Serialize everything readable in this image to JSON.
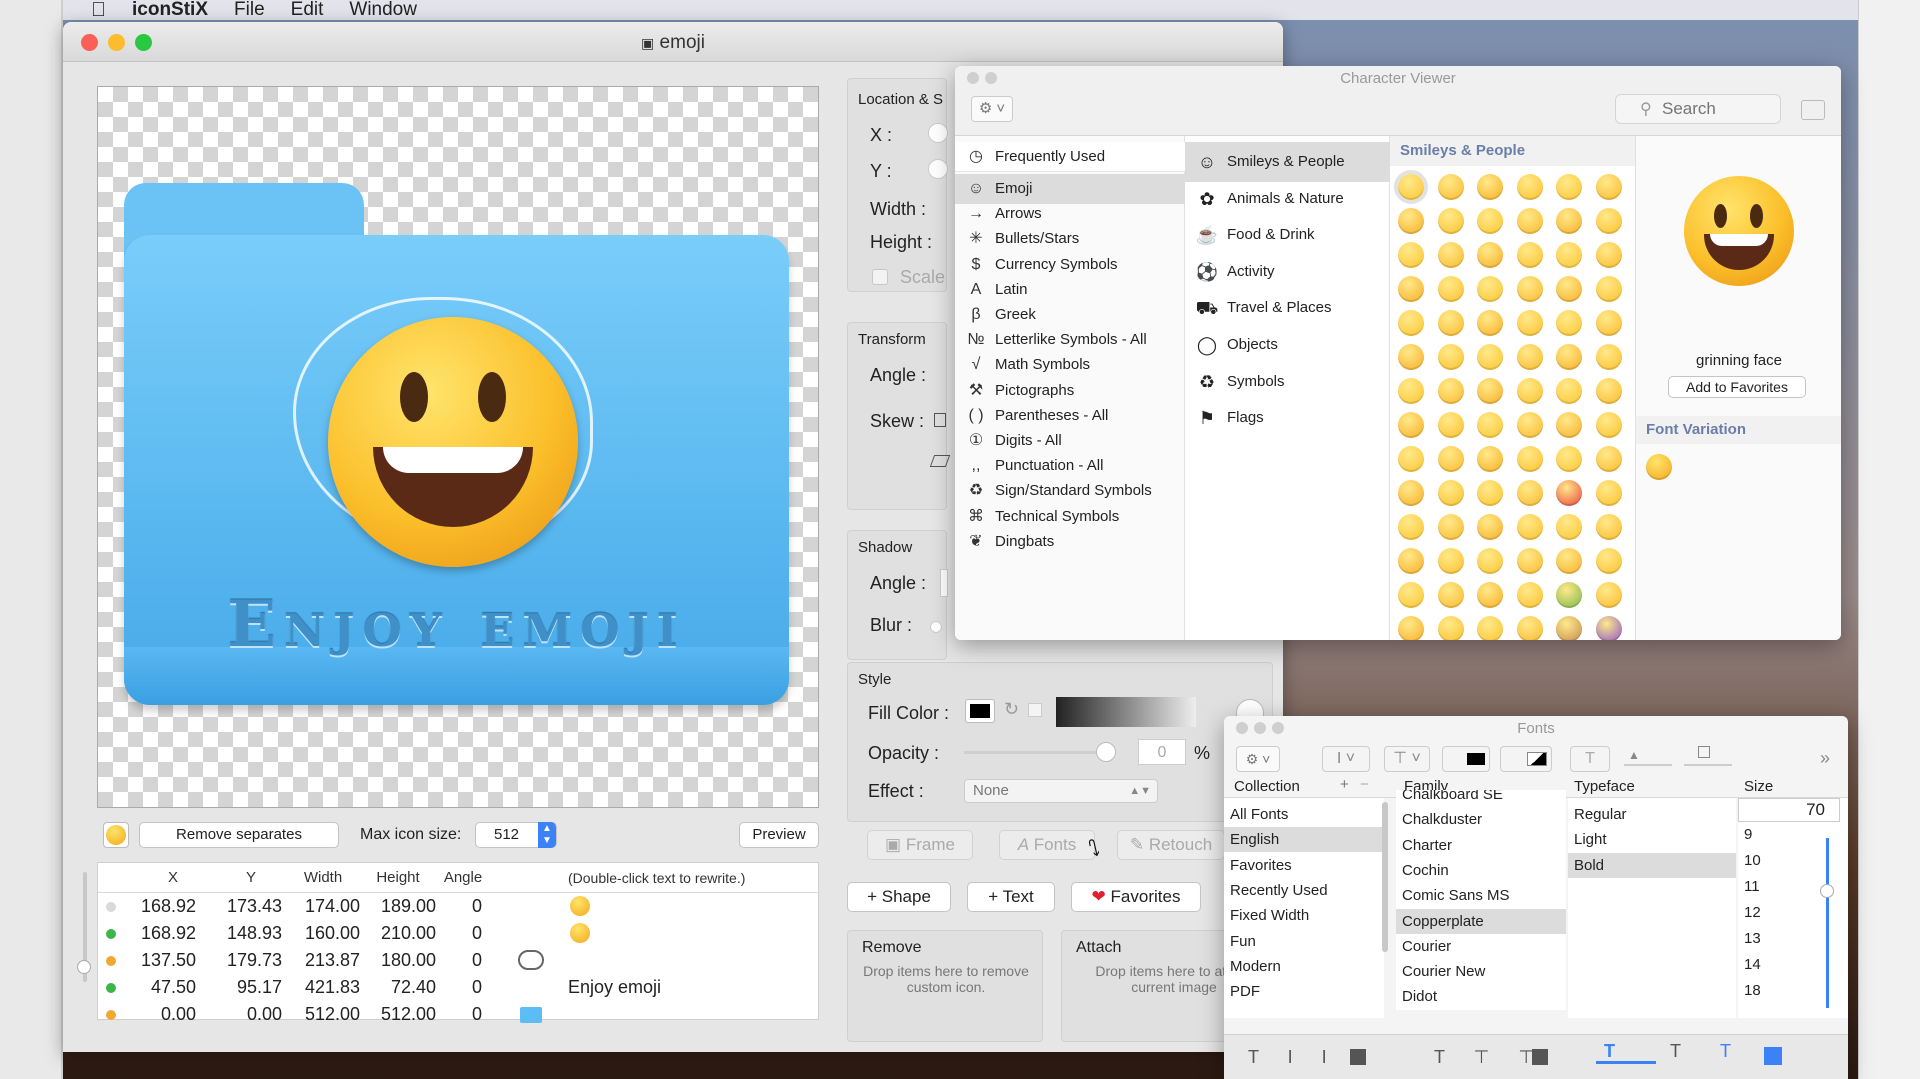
{
  "menubar": {
    "app": "iconStiX",
    "items": [
      "File",
      "Edit",
      "Window"
    ]
  },
  "window": {
    "title": "emoji"
  },
  "canvas": {
    "folder_text": "Enjoy emoji"
  },
  "toolbar": {
    "remove_separates": "Remove separates",
    "max_icon_size_label": "Max icon size:",
    "max_icon_size": "512",
    "preview": "Preview"
  },
  "table": {
    "headers": [
      "X",
      "Y",
      "Width",
      "Height",
      "Angle",
      "(Double-click text to rewrite.)"
    ],
    "rows": [
      {
        "dot": "#d9d9d9",
        "x": "168.92",
        "y": "173.43",
        "w": "174.00",
        "h": "189.00",
        "a": "0",
        "content": "",
        "icon": "emoji-icon"
      },
      {
        "dot": "#3cb54a",
        "x": "168.92",
        "y": "148.93",
        "w": "160.00",
        "h": "210.00",
        "a": "0",
        "content": "",
        "icon": "emoji-icon"
      },
      {
        "dot": "#f0a830",
        "x": "137.50",
        "y": "179.73",
        "w": "213.87",
        "h": "180.00",
        "a": "0",
        "content": "",
        "icon": "cloud-outline-icon"
      },
      {
        "dot": "#3cb54a",
        "x": "47.50",
        "y": "95.17",
        "w": "421.83",
        "h": "72.40",
        "a": "0",
        "content": "Enjoy emoji",
        "icon": ""
      },
      {
        "dot": "#f0a830",
        "x": "0.00",
        "y": "0.00",
        "w": "512.00",
        "h": "512.00",
        "a": "0",
        "content": "",
        "icon": "folder-icon"
      }
    ]
  },
  "inspector": {
    "location_title": "Location & S",
    "x_label": "X :",
    "y_label": "Y :",
    "width_label": "Width :",
    "height_label": "Height :",
    "scale_label": "Scale",
    "transform_title": "Transform",
    "angle_label": "Angle :",
    "skew_label": "Skew :",
    "shadow_title": "Shadow",
    "shadow_angle_label": "Angle :",
    "blur_label": "Blur :",
    "style_title": "Style",
    "fill_color_label": "Fill Color :",
    "opacity_label": "Opacity :",
    "opacity_value": "0",
    "opacity_unit": "%",
    "effect_label": "Effect :",
    "effect_value": "None",
    "frame_btn": "Frame",
    "fonts_btn": "Fonts",
    "retouch_btn": "Retouch",
    "shape_btn": "Shape",
    "text_btn": "Text",
    "favorites_btn": "Favorites",
    "remove_title": "Remove",
    "remove_hint": "Drop items here to remove custom icon.",
    "attach_title": "Attach",
    "attach_hint": "Drop items here to attach current image"
  },
  "character_viewer": {
    "title": "Character Viewer",
    "search_placeholder": "Search",
    "categories": [
      {
        "label": "Frequently Used",
        "icon": "clock-icon"
      },
      {
        "label": "Emoji",
        "icon": "smiley-icon"
      },
      {
        "label": "Arrows",
        "icon": "arrow-icon"
      },
      {
        "label": "Bullets/Stars",
        "icon": "asterisk-icon"
      },
      {
        "label": "Currency Symbols",
        "icon": "dollar-icon"
      },
      {
        "label": "Latin",
        "icon": "latin-a-icon"
      },
      {
        "label": "Greek",
        "icon": "beta-icon"
      },
      {
        "label": "Letterlike Symbols - All",
        "icon": "numero-icon"
      },
      {
        "label": "Math Symbols",
        "icon": "sqrt-icon"
      },
      {
        "label": "Pictographs",
        "icon": "pictograph-icon"
      },
      {
        "label": "Parentheses - All",
        "icon": "parentheses-icon"
      },
      {
        "label": "Digits - All",
        "icon": "digit-icon"
      },
      {
        "label": "Punctuation - All",
        "icon": "punctuation-icon"
      },
      {
        "label": "Sign/Standard Symbols",
        "icon": "recycle-icon"
      },
      {
        "label": "Technical Symbols",
        "icon": "command-icon"
      },
      {
        "label": "Dingbats",
        "icon": "dingbat-icon"
      }
    ],
    "subcategories": [
      {
        "label": "Smileys & People",
        "icon": "smiley-icon"
      },
      {
        "label": "Animals & Nature",
        "icon": "paw-icon"
      },
      {
        "label": "Food & Drink",
        "icon": "food-icon"
      },
      {
        "label": "Activity",
        "icon": "ball-icon"
      },
      {
        "label": "Travel & Places",
        "icon": "car-icon"
      },
      {
        "label": "Objects",
        "icon": "bulb-icon"
      },
      {
        "label": "Symbols",
        "icon": "symbols-icon"
      },
      {
        "label": "Flags",
        "icon": "flag-icon"
      }
    ],
    "grid_title": "Smileys & People",
    "selected_name": "grinning face",
    "add_favorites": "Add to Favorites",
    "font_variation": "Font Variation"
  },
  "fonts_panel": {
    "title": "Fonts",
    "collection_header": "Collection",
    "family_header": "Family",
    "typeface_header": "Typeface",
    "size_header": "Size",
    "collections": [
      "All Fonts",
      "English",
      "Favorites",
      "Recently Used",
      "Fixed Width",
      "Fun",
      "Modern",
      "PDF"
    ],
    "families": [
      "Chalkboard SE",
      "Chalkduster",
      "Charter",
      "Cochin",
      "Comic Sans MS",
      "Copperplate",
      "Courier",
      "Courier New",
      "Didot"
    ],
    "typefaces": [
      "Regular",
      "Light",
      "Bold"
    ],
    "size_value": "70",
    "sizes": [
      "9",
      "10",
      "11",
      "12",
      "13",
      "14",
      "18"
    ]
  },
  "colors": {
    "accent": "#3b82f6",
    "folder": "#5cbcf4",
    "emoji": "#fbbf2a"
  }
}
